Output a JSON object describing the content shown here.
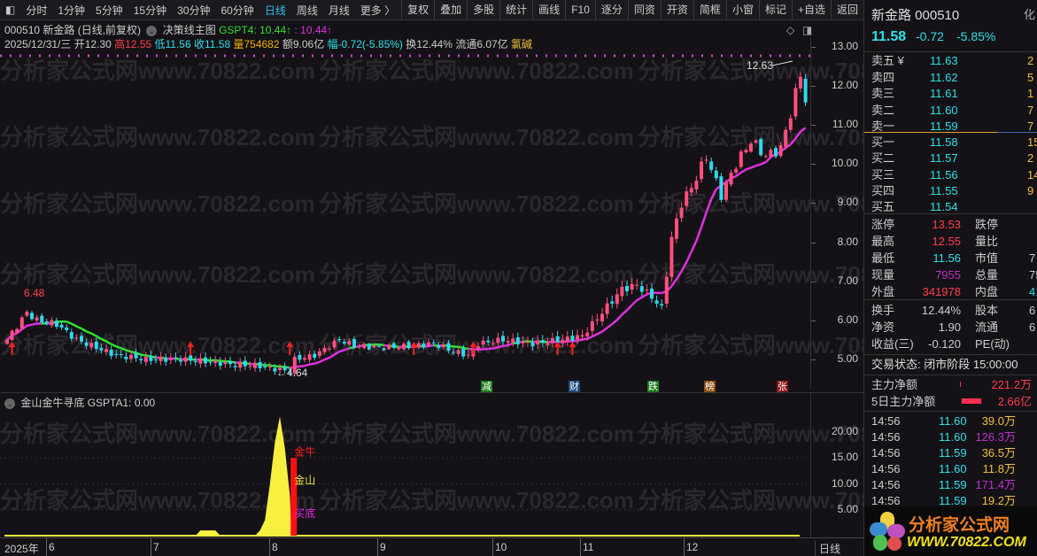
{
  "toolbar": {
    "periods": [
      "分时",
      "1分钟",
      "5分钟",
      "15分钟",
      "30分钟",
      "60分钟",
      "日线",
      "周线",
      "月线",
      "更多 〉"
    ],
    "active": "日线",
    "tools": [
      "复权",
      "叠加",
      "多股",
      "统计",
      "画线",
      "F10",
      "逐分",
      "同资",
      "开资",
      "简框",
      "小窗",
      "标记",
      "+自选",
      "返回"
    ]
  },
  "header": {
    "line1": {
      "code_name": "000510 新金路 (日线,前复权)",
      "main_chart": "决策线主图",
      "gspt4": "GSPT4: 10.44↑",
      "gspt4b": ": 10.44↑"
    },
    "line2": {
      "date": "2025/12/31/三",
      "open": "开12.30",
      "high": "高12.55",
      "low": "低11.56",
      "close": "收11.58",
      "vol": "量754682",
      "amount": "额9.06亿",
      "change": "幅-0.72(-5.85%)",
      "turnover": "换12.44%",
      "float": "流通6.07亿",
      "sector": "氯碱"
    }
  },
  "price_axis": [
    "13.00",
    "12.00",
    "11.00",
    "10.00",
    "9.00",
    "8.00",
    "7.00",
    "6.00",
    "5.00"
  ],
  "annotations": {
    "high": "12.63",
    "low": "4.64",
    "left_high": "6.48"
  },
  "event_markers": [
    {
      "t": "减",
      "c": "#1a7a1a"
    },
    {
      "t": "财",
      "c": "#1a4a7a"
    },
    {
      "t": "跌",
      "c": "#1a7a1a"
    },
    {
      "t": "榜",
      "c": "#8a4a10"
    },
    {
      "t": "张",
      "c": "#8a1010"
    }
  ],
  "price_keypoints": [
    [
      0,
      5.5
    ],
    [
      4,
      6.2
    ],
    [
      6,
      6.0
    ],
    [
      10,
      5.9
    ],
    [
      14,
      5.5
    ],
    [
      18,
      5.3
    ],
    [
      22,
      5.1
    ],
    [
      28,
      5.0
    ],
    [
      35,
      5.0
    ],
    [
      40,
      4.95
    ],
    [
      46,
      4.85
    ],
    [
      50,
      4.85
    ],
    [
      54,
      4.75
    ],
    [
      57,
      4.7
    ],
    [
      58,
      5.0
    ],
    [
      62,
      5.1
    ],
    [
      67,
      5.5
    ],
    [
      70,
      5.35
    ],
    [
      76,
      5.3
    ],
    [
      82,
      5.35
    ],
    [
      86,
      5.4
    ],
    [
      90,
      5.2
    ],
    [
      93,
      5.1
    ],
    [
      95,
      5.4
    ],
    [
      100,
      5.5
    ],
    [
      106,
      5.4
    ],
    [
      112,
      5.5
    ],
    [
      116,
      5.6
    ],
    [
      120,
      6.2
    ],
    [
      124,
      6.8
    ],
    [
      127,
      6.9
    ],
    [
      130,
      6.6
    ],
    [
      132,
      6.3
    ],
    [
      134,
      8.1
    ],
    [
      136,
      9.0
    ],
    [
      138,
      9.4
    ],
    [
      141,
      10.2
    ],
    [
      144,
      9.2
    ],
    [
      147,
      10.0
    ],
    [
      150,
      10.6
    ],
    [
      153,
      10.2
    ],
    [
      156,
      10.4
    ],
    [
      158,
      11.3
    ],
    [
      160,
      12.3
    ],
    [
      161,
      11.58
    ]
  ],
  "buy_arrow_days": [
    1,
    37,
    57,
    82,
    94,
    111,
    114
  ],
  "indicator": {
    "title": "金山金牛寻底",
    "value": "GSPTA1: 0.00",
    "axis": [
      "20.00",
      "15.00",
      "10.00",
      "5.00"
    ],
    "labels": {
      "jinniu": "金牛",
      "jinshan": "金山",
      "maidi": "买底"
    },
    "area": [
      [
        38,
        0
      ],
      [
        39,
        1
      ],
      [
        42,
        1
      ],
      [
        43,
        0
      ],
      [
        50,
        0
      ],
      [
        51,
        1
      ],
      [
        52,
        3
      ],
      [
        53,
        10
      ],
      [
        54,
        18
      ],
      [
        55,
        23
      ],
      [
        56,
        17
      ],
      [
        57,
        8
      ],
      [
        57.4,
        0
      ]
    ],
    "bar_day": 57,
    "bar_value": 15
  },
  "date_axis": {
    "year": "2025年",
    "months": [
      "6",
      "7",
      "8",
      "9",
      "10",
      "11",
      "12"
    ],
    "period": "日线"
  },
  "quote": {
    "name": "新金路 000510",
    "price": "11.58",
    "change": "-0.72",
    "pct": "-5.85%",
    "cut": "化"
  },
  "book": {
    "asks": [
      [
        "卖五 ¥",
        "11.63",
        "2"
      ],
      [
        "卖四",
        "11.62",
        "5"
      ],
      [
        "卖三",
        "11.61",
        "1"
      ],
      [
        "卖二",
        "11.60",
        "7"
      ],
      [
        "卖一",
        "11.59",
        "7"
      ]
    ],
    "bids": [
      [
        "买一",
        "11.58",
        "15"
      ],
      [
        "买二",
        "11.57",
        "2"
      ],
      [
        "买三",
        "11.56",
        "14"
      ],
      [
        "买四",
        "11.55",
        "9"
      ],
      [
        "买五",
        "11.54",
        ""
      ]
    ]
  },
  "stats": [
    [
      "涨停",
      "13.53",
      "跌停",
      ""
    ],
    [
      "最高",
      "12.55",
      "量比",
      ""
    ],
    [
      "最低",
      "11.56",
      "市值",
      "7"
    ],
    [
      "现量",
      "7955",
      "总量",
      "75"
    ],
    [
      "外盘",
      "341978",
      "内盘",
      "41"
    ]
  ],
  "stats2": [
    [
      "换手",
      "12.44%",
      "股本",
      "6"
    ],
    [
      "净资",
      "1.90",
      "流通",
      "6"
    ],
    [
      "收益(三)",
      "-0.120",
      "PE(动)",
      ""
    ]
  ],
  "trade_status": "交易状态: 闭市阶段 15:00:00",
  "flow": [
    [
      "主力净额",
      "221.2万"
    ],
    [
      "5日主力净额",
      "2.66亿"
    ]
  ],
  "ticks": [
    [
      "14:56",
      "11.60",
      "39.0万"
    ],
    [
      "14:56",
      "11.60",
      "126.3万"
    ],
    [
      "14:56",
      "11.59",
      "36.5万"
    ],
    [
      "14:56",
      "11.60",
      "11.8万"
    ],
    [
      "14:56",
      "11.59",
      "171.4万"
    ],
    [
      "14:56",
      "11.59",
      "19.2万"
    ]
  ],
  "logo": {
    "name": "分析家公式网",
    "url": "WWW.70822.COM"
  },
  "watermark": "分析家公式网www.70822.com"
}
